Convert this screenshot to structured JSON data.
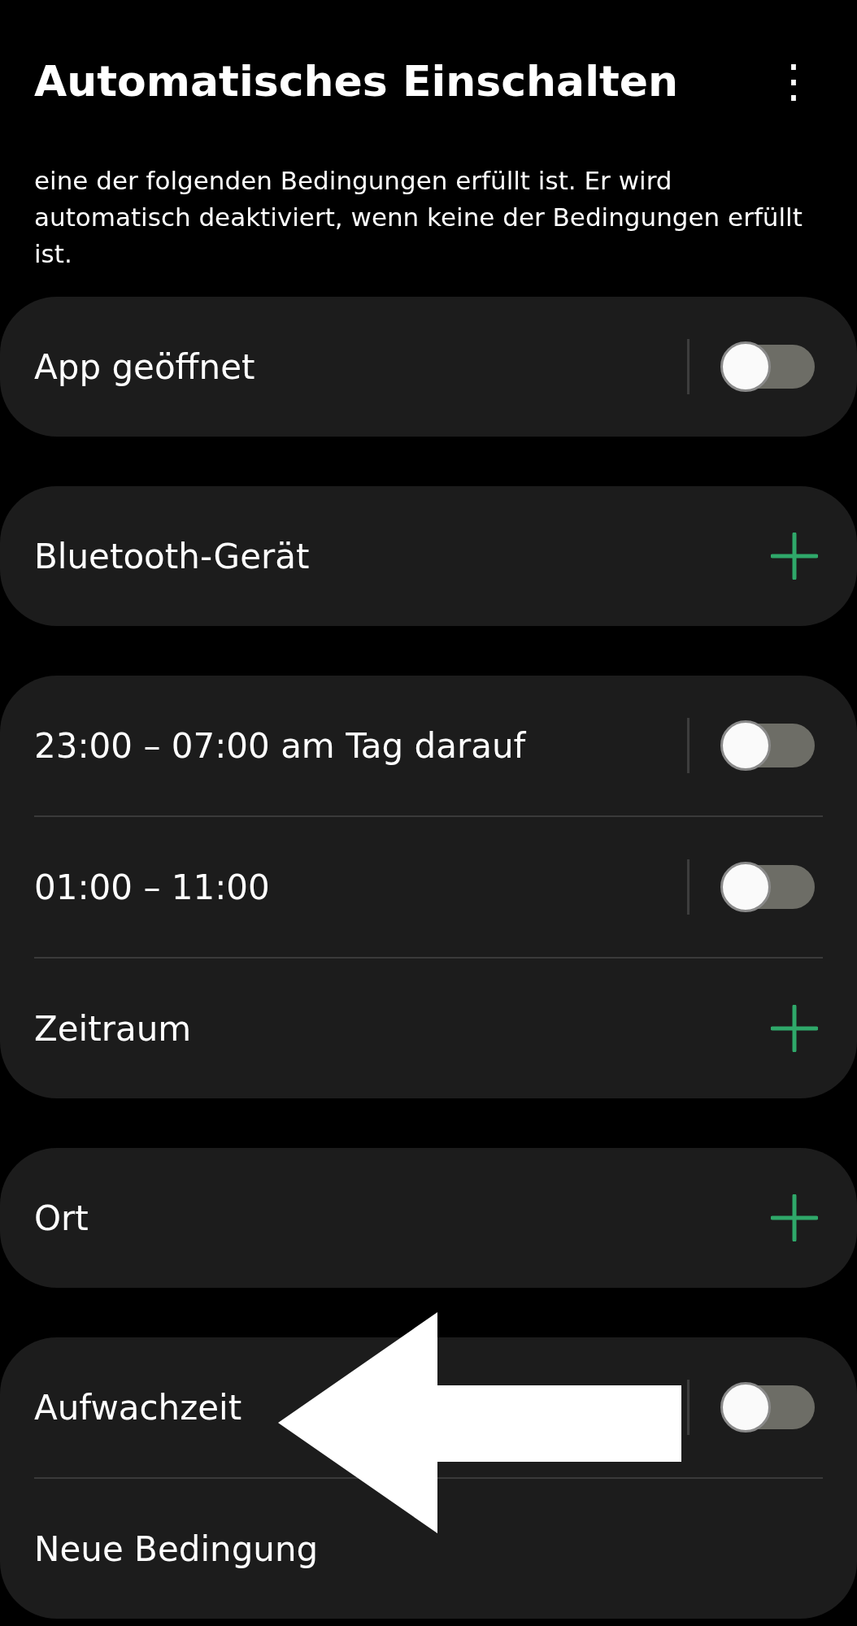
{
  "header": {
    "title": "Automatisches Einschalten",
    "menu_icon": "⋮"
  },
  "description": "eine der folgenden Bedingungen erfüllt ist. Er wird automatisch deaktiviert, wenn keine der Bedingungen erfüllt ist.",
  "groups": [
    {
      "rows": [
        {
          "label": "App geöffnet",
          "kind": "toggle",
          "on": false
        }
      ]
    },
    {
      "rows": [
        {
          "label": "Bluetooth-Gerät",
          "kind": "add"
        }
      ]
    },
    {
      "rows": [
        {
          "label": "23:00 – 07:00 am Tag darauf",
          "kind": "toggle",
          "on": false
        },
        {
          "label": "01:00 – 11:00",
          "kind": "toggle",
          "on": false
        },
        {
          "label": "Zeitraum",
          "kind": "add"
        }
      ]
    },
    {
      "rows": [
        {
          "label": "Ort",
          "kind": "add"
        }
      ]
    },
    {
      "rows": [
        {
          "label": "Aufwachzeit",
          "kind": "toggle",
          "on": false
        },
        {
          "label": "Neue Bedingung",
          "kind": "text"
        }
      ]
    }
  ]
}
